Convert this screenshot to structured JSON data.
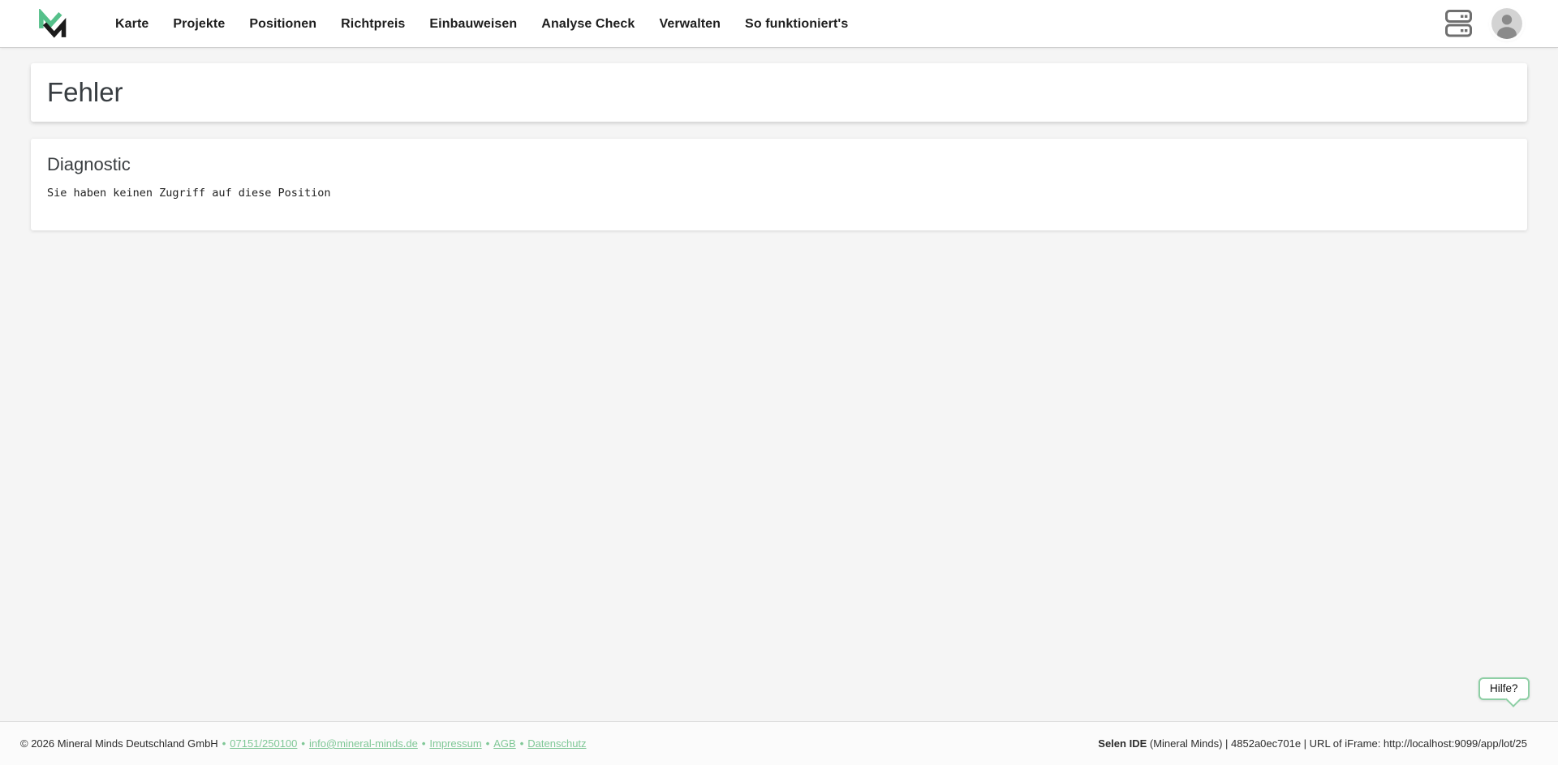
{
  "brand": {
    "logo_green": "#55c08a",
    "logo_black": "#1b1b1b"
  },
  "nav": {
    "items": [
      {
        "label": "Karte"
      },
      {
        "label": "Projekte"
      },
      {
        "label": "Positionen"
      },
      {
        "label": "Richtpreis"
      },
      {
        "label": "Einbauweisen"
      },
      {
        "label": "Analyse Check"
      },
      {
        "label": "Verwalten"
      },
      {
        "label": "So funktioniert's"
      }
    ]
  },
  "page": {
    "title": "Fehler"
  },
  "diagnostic": {
    "title": "Diagnostic",
    "message": "Sie haben keinen Zugriff auf diese Position"
  },
  "help": {
    "label": "Hilfe?"
  },
  "footer": {
    "copyright": "© 2026 Mineral Minds Deutschland GmbH",
    "separator": "•",
    "links": [
      {
        "label": "07151/250100"
      },
      {
        "label": "info@mineral-minds.de"
      },
      {
        "label": "Impressum"
      },
      {
        "label": "AGB"
      },
      {
        "label": "Datenschutz"
      }
    ],
    "right": {
      "app": "Selen IDE",
      "rest": " (Mineral Minds) | 4852a0ec701e | URL of iFrame: http://localhost:9099/app/lot/25"
    }
  },
  "colors": {
    "link_green": "#7fc796",
    "bubble_border": "#8ecfa5",
    "page_background": "#f5f5f5",
    "icon_gray": "#6f6f6f"
  }
}
